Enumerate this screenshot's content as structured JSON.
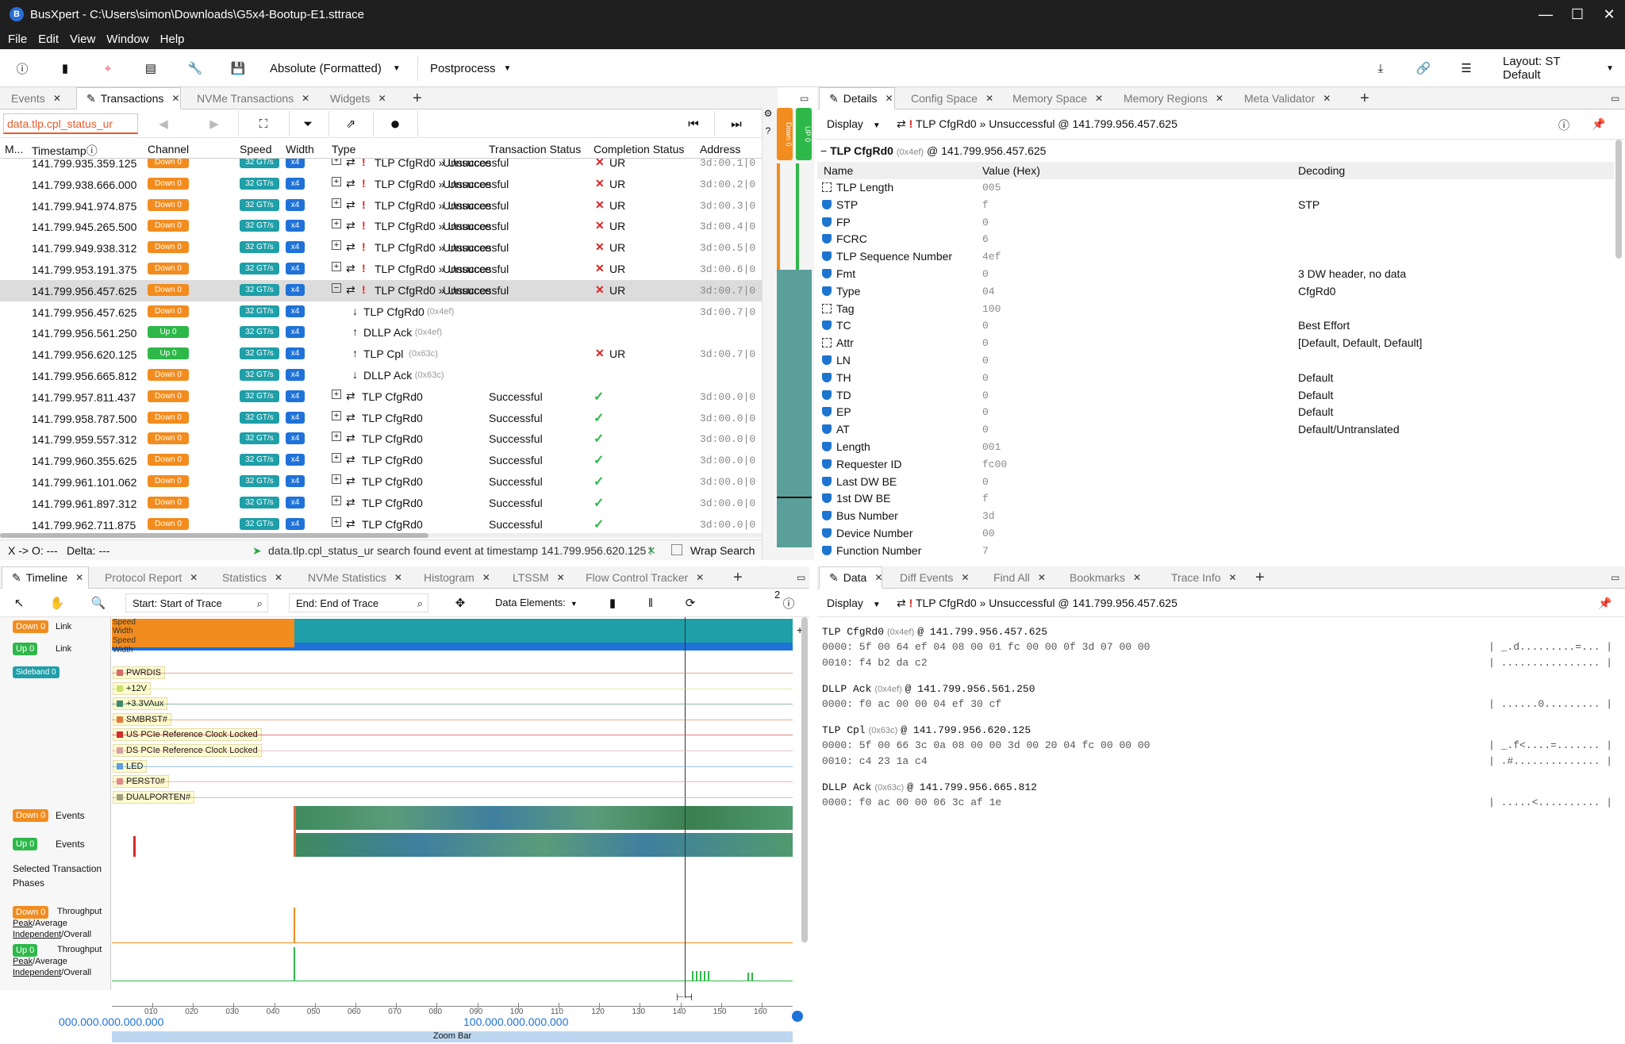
{
  "window": {
    "title": "BusXpert - C:\\Users\\simon\\Downloads\\G5x4-Bootup-E1.sttrace",
    "minimize": "—",
    "maximize": "☐",
    "close": "✕"
  },
  "menu": [
    "File",
    "Edit",
    "View",
    "Window",
    "Help"
  ],
  "toolbar": {
    "time_format": "Absolute (Formatted)",
    "postprocess": "Postprocess",
    "layout": "Layout: ST Default"
  },
  "left_tabs": [
    {
      "label": "Events",
      "active": false
    },
    {
      "label": "Transactions",
      "active": true
    },
    {
      "label": "NVMe Transactions",
      "active": false
    },
    {
      "label": "Widgets",
      "active": false
    }
  ],
  "filter": {
    "value": "data.tlp.cpl_status_ur"
  },
  "columns": [
    "M...",
    "Timestamp",
    "Channel",
    "Speed",
    "Width",
    "Type",
    "Transaction Status",
    "Completion Status",
    "Address"
  ],
  "rows": [
    {
      "ts": "141.799.935.359.125",
      "ch": "Down 0",
      "dir": "down",
      "sp": "32 GT/s",
      "w": "x4",
      "exp": "+",
      "warn": true,
      "type": "TLP CfgRd0 » Unsucce",
      "status": "Unsuccessful",
      "comp": "UR",
      "ok": false,
      "addr": "3d:00.1|0"
    },
    {
      "ts": "141.799.938.666.000",
      "ch": "Down 0",
      "dir": "down",
      "sp": "32 GT/s",
      "w": "x4",
      "exp": "+",
      "warn": true,
      "type": "TLP CfgRd0 » Unsucce",
      "status": "Unsuccessful",
      "comp": "UR",
      "ok": false,
      "addr": "3d:00.2|0"
    },
    {
      "ts": "141.799.941.974.875",
      "ch": "Down 0",
      "dir": "down",
      "sp": "32 GT/s",
      "w": "x4",
      "exp": "+",
      "warn": true,
      "type": "TLP CfgRd0 » Unsucce",
      "status": "Unsuccessful",
      "comp": "UR",
      "ok": false,
      "addr": "3d:00.3|0"
    },
    {
      "ts": "141.799.945.265.500",
      "ch": "Down 0",
      "dir": "down",
      "sp": "32 GT/s",
      "w": "x4",
      "exp": "+",
      "warn": true,
      "type": "TLP CfgRd0 » Unsucce",
      "status": "Unsuccessful",
      "comp": "UR",
      "ok": false,
      "addr": "3d:00.4|0"
    },
    {
      "ts": "141.799.949.938.312",
      "ch": "Down 0",
      "dir": "down",
      "sp": "32 GT/s",
      "w": "x4",
      "exp": "+",
      "warn": true,
      "type": "TLP CfgRd0 » Unsucce",
      "status": "Unsuccessful",
      "comp": "UR",
      "ok": false,
      "addr": "3d:00.5|0"
    },
    {
      "ts": "141.799.953.191.375",
      "ch": "Down 0",
      "dir": "down",
      "sp": "32 GT/s",
      "w": "x4",
      "exp": "+",
      "warn": true,
      "type": "TLP CfgRd0 » Unsucce",
      "status": "Unsuccessful",
      "comp": "UR",
      "ok": false,
      "addr": "3d:00.6|0"
    },
    {
      "ts": "141.799.956.457.625",
      "ch": "Down 0",
      "dir": "down",
      "sp": "32 GT/s",
      "w": "x4",
      "exp": "−",
      "warn": true,
      "type": "TLP CfgRd0 » Unsucce",
      "status": "Unsuccessful",
      "comp": "UR",
      "ok": false,
      "addr": "3d:00.7|0",
      "sel": true
    },
    {
      "ts": "141.799.956.457.625",
      "ch": "Down 0",
      "dir": "down",
      "sp": "32 GT/s",
      "w": "x4",
      "child": "↓",
      "type": "TLP CfgRd0",
      "tag": "(0x4ef)",
      "status": "",
      "comp": "",
      "addr": "3d:00.7|0"
    },
    {
      "ts": "141.799.956.561.250",
      "ch": "Up 0",
      "dir": "up",
      "sp": "32 GT/s",
      "w": "x4",
      "child": "↑",
      "type": "DLLP Ack",
      "tag": "(0x4ef)",
      "status": "",
      "comp": "",
      "addr": ""
    },
    {
      "ts": "141.799.956.620.125",
      "ch": "Up 0",
      "dir": "up",
      "sp": "32 GT/s",
      "w": "x4",
      "child": "↑",
      "type": "TLP Cpl",
      "tag": "(0x63c)",
      "status": "",
      "comp": "UR",
      "ok": false,
      "addr": "3d:00.7|0"
    },
    {
      "ts": "141.799.956.665.812",
      "ch": "Down 0",
      "dir": "down",
      "sp": "32 GT/s",
      "w": "x4",
      "child": "↓",
      "type": "DLLP Ack",
      "tag": "(0x63c)",
      "status": "",
      "comp": "",
      "addr": ""
    },
    {
      "ts": "141.799.957.811.437",
      "ch": "Down 0",
      "dir": "down",
      "sp": "32 GT/s",
      "w": "x4",
      "exp": "+",
      "type": "TLP CfgRd0",
      "status": "Successful",
      "comp": "",
      "ok": true,
      "addr": "3d:00.0|0"
    },
    {
      "ts": "141.799.958.787.500",
      "ch": "Down 0",
      "dir": "down",
      "sp": "32 GT/s",
      "w": "x4",
      "exp": "+",
      "type": "TLP CfgRd0",
      "status": "Successful",
      "comp": "",
      "ok": true,
      "addr": "3d:00.0|0"
    },
    {
      "ts": "141.799.959.557.312",
      "ch": "Down 0",
      "dir": "down",
      "sp": "32 GT/s",
      "w": "x4",
      "exp": "+",
      "type": "TLP CfgRd0",
      "status": "Successful",
      "comp": "",
      "ok": true,
      "addr": "3d:00.0|0"
    },
    {
      "ts": "141.799.960.355.625",
      "ch": "Down 0",
      "dir": "down",
      "sp": "32 GT/s",
      "w": "x4",
      "exp": "+",
      "type": "TLP CfgRd0",
      "status": "Successful",
      "comp": "",
      "ok": true,
      "addr": "3d:00.0|0"
    },
    {
      "ts": "141.799.961.101.062",
      "ch": "Down 0",
      "dir": "down",
      "sp": "32 GT/s",
      "w": "x4",
      "exp": "+",
      "type": "TLP CfgRd0",
      "status": "Successful",
      "comp": "",
      "ok": true,
      "addr": "3d:00.0|0"
    },
    {
      "ts": "141.799.961.897.312",
      "ch": "Down 0",
      "dir": "down",
      "sp": "32 GT/s",
      "w": "x4",
      "exp": "+",
      "type": "TLP CfgRd0",
      "status": "Successful",
      "comp": "",
      "ok": true,
      "addr": "3d:00.0|0"
    },
    {
      "ts": "141.799.962.711.875",
      "ch": "Down 0",
      "dir": "down",
      "sp": "32 GT/s",
      "w": "x4",
      "exp": "+",
      "type": "TLP CfgRd0",
      "status": "Successful",
      "comp": "",
      "ok": true,
      "addr": "3d:00.0|0"
    }
  ],
  "statusbar": {
    "xo": "X -> O: ---",
    "delta": "Delta: ---",
    "msg": "data.tlp.cpl_status_ur search found event at timestamp 141.799.956.620.125 !",
    "wrap": "Wrap Search"
  },
  "mini": {
    "down": "Down 0",
    "up": "UP 0"
  },
  "right_tabs": [
    {
      "label": "Details",
      "active": true
    },
    {
      "label": "Config Space",
      "active": false
    },
    {
      "label": "Memory Space",
      "active": false
    },
    {
      "label": "Memory Regions",
      "active": false
    },
    {
      "label": "Meta Validator",
      "active": false
    }
  ],
  "details": {
    "display": "Display",
    "header": "TLP CfgRd0 » Unsuccessful @ 141.799.956.457.625",
    "title": "TLP CfgRd0",
    "title_tag": "(0x4ef)",
    "title_ts": "@ 141.799.956.457.625",
    "cols": [
      "Name",
      "Value (Hex)",
      "Decoding"
    ],
    "fields": [
      {
        "n": "TLP Length",
        "v": "005",
        "d": "",
        "i": "box"
      },
      {
        "n": "STP",
        "v": "f",
        "d": "STP",
        "i": "shield"
      },
      {
        "n": "FP",
        "v": "0",
        "d": "",
        "i": "shield"
      },
      {
        "n": "FCRC",
        "v": "6",
        "d": "",
        "i": "shield"
      },
      {
        "n": "TLP Sequence Number",
        "v": "4ef",
        "d": "",
        "i": "shield"
      },
      {
        "n": "Fmt",
        "v": "0",
        "d": "3 DW header, no data",
        "i": "shield"
      },
      {
        "n": "Type",
        "v": "04",
        "d": "CfgRd0",
        "i": "shield"
      },
      {
        "n": "Tag",
        "v": "100",
        "d": "",
        "i": "box"
      },
      {
        "n": "TC",
        "v": "0",
        "d": "Best Effort",
        "i": "shield"
      },
      {
        "n": "Attr",
        "v": "0",
        "d": "[Default, Default, Default]",
        "i": "box"
      },
      {
        "n": "LN",
        "v": "0",
        "d": "",
        "i": "shield"
      },
      {
        "n": "TH",
        "v": "0",
        "d": "Default",
        "i": "shield"
      },
      {
        "n": "TD",
        "v": "0",
        "d": "Default",
        "i": "shield"
      },
      {
        "n": "EP",
        "v": "0",
        "d": "Default",
        "i": "shield"
      },
      {
        "n": "AT",
        "v": "0",
        "d": "Default/Untranslated",
        "i": "shield"
      },
      {
        "n": "Length",
        "v": "001",
        "d": "",
        "i": "shield"
      },
      {
        "n": "Requester ID",
        "v": "fc00",
        "d": "",
        "i": "shield"
      },
      {
        "n": "Last DW BE",
        "v": "0",
        "d": "",
        "i": "shield"
      },
      {
        "n": "1st DW BE",
        "v": "f",
        "d": "",
        "i": "shield"
      },
      {
        "n": "Bus Number",
        "v": "3d",
        "d": "",
        "i": "shield"
      },
      {
        "n": "Device Number",
        "v": "00",
        "d": "",
        "i": "shield"
      },
      {
        "n": "Function Number",
        "v": "7",
        "d": "",
        "i": "shield"
      }
    ]
  },
  "bottom_left_tabs": [
    {
      "label": "Timeline",
      "active": true
    },
    {
      "label": "Protocol Report",
      "active": false
    },
    {
      "label": "Statistics",
      "active": false
    },
    {
      "label": "NVMe Statistics",
      "active": false
    },
    {
      "label": "Histogram",
      "active": false
    },
    {
      "label": "LTSSM",
      "active": false
    },
    {
      "label": "Flow Control Tracker",
      "active": false
    }
  ],
  "timeline": {
    "start": "Start: Start of Trace",
    "end": "End: End of Trace",
    "elements": "Data Elements:",
    "counter": "2",
    "link_rows": [
      {
        "badge": "Down 0",
        "label": "Link",
        "dir": "down"
      },
      {
        "badge": "Up 0",
        "label": "Link",
        "dir": "up"
      }
    ],
    "link_labels": [
      "Speed",
      "Width",
      "Speed",
      "Width"
    ],
    "sideband": "Sideband 0",
    "signals": [
      {
        "n": "PWRDIS",
        "c": "#d86a6a"
      },
      {
        "n": "+12V",
        "c": "#c9e06a"
      },
      {
        "n": "+3.3VAux",
        "c": "#3f8a6a"
      },
      {
        "n": "SMBRST#",
        "c": "#e07a3a"
      },
      {
        "n": "US PCIe Reference Clock Locked",
        "c": "#d02a2a"
      },
      {
        "n": "DS PCIe Reference Clock Locked",
        "c": "#d8a0a0"
      },
      {
        "n": "LED",
        "c": "#5aa0e0"
      },
      {
        "n": "PERST0#",
        "c": "#e08a8a"
      },
      {
        "n": "DUALPORTEN#",
        "c": "#a0a080"
      }
    ],
    "events": [
      {
        "badge": "Down 0",
        "label": "Events",
        "dir": "down"
      },
      {
        "badge": "Up 0",
        "label": "Events",
        "dir": "up"
      }
    ],
    "selected": "Selected Transaction",
    "phases": "Phases",
    "throughput": [
      {
        "badge": "Down 0",
        "label": "Throughput",
        "peak": "Peak",
        "avg": "/Average",
        "ind": "Independent",
        "ov": "/Overall",
        "dir": "down"
      },
      {
        "badge": "Up 0",
        "label": "Throughput",
        "peak": "Peak",
        "avg": "/Average",
        "ind": "Independent",
        "ov": "/Overall",
        "dir": "up"
      }
    ],
    "ticks": [
      "010",
      "020",
      "030",
      "040",
      "050",
      "060",
      "070",
      "080",
      "090",
      "100",
      "110",
      "120",
      "130",
      "140",
      "150",
      "160"
    ],
    "left_time": "000.000.000.000.000",
    "mid_time": "100.000.000.000.000",
    "zoom": "Zoom Bar"
  },
  "bottom_right_tabs": [
    {
      "label": "Data",
      "active": true
    },
    {
      "label": "Diff Events",
      "active": false
    },
    {
      "label": "Find All",
      "active": false
    },
    {
      "label": "Bookmarks",
      "active": false
    },
    {
      "label": "Trace Info",
      "active": false
    }
  ],
  "data_panel": {
    "display": "Display",
    "header": "TLP CfgRd0 » Unsuccessful @ 141.799.956.457.625",
    "blocks": [
      {
        "title": "TLP CfgRd0",
        "tag": "(0x4ef)",
        "ts": "@ 141.799.956.457.625",
        "lines": [
          {
            "h": "0000: 5f 00 64 ef 04 08 00 01 fc 00 00 0f 3d 07 00 00",
            "a": "| _.d.........=... |"
          },
          {
            "h": "0010: f4 b2 da c2",
            "a": "| ................ |"
          }
        ]
      },
      {
        "title": "DLLP Ack",
        "tag": "(0x4ef)",
        "ts": "@ 141.799.956.561.250",
        "lines": [
          {
            "h": "0000: f0 ac 00 00 04 ef 30 cf",
            "a": "| ......0......... |"
          }
        ]
      },
      {
        "title": "TLP Cpl",
        "tag": "(0x63c)",
        "ts": "@ 141.799.956.620.125",
        "lines": [
          {
            "h": "0000: 5f 00 66 3c 0a 08 00 00 3d 00 20 04 fc 00 00 00",
            "a": "| _.f<....=....... |"
          },
          {
            "h": "0010: c4 23 1a c4",
            "a": "| .#.............. |"
          }
        ]
      },
      {
        "title": "DLLP Ack",
        "tag": "(0x63c)",
        "ts": "@ 141.799.956.665.812",
        "lines": [
          {
            "h": "0000: f0 ac 00 00 06 3c af 1e",
            "a": "| .....<.......... |"
          }
        ]
      }
    ]
  }
}
